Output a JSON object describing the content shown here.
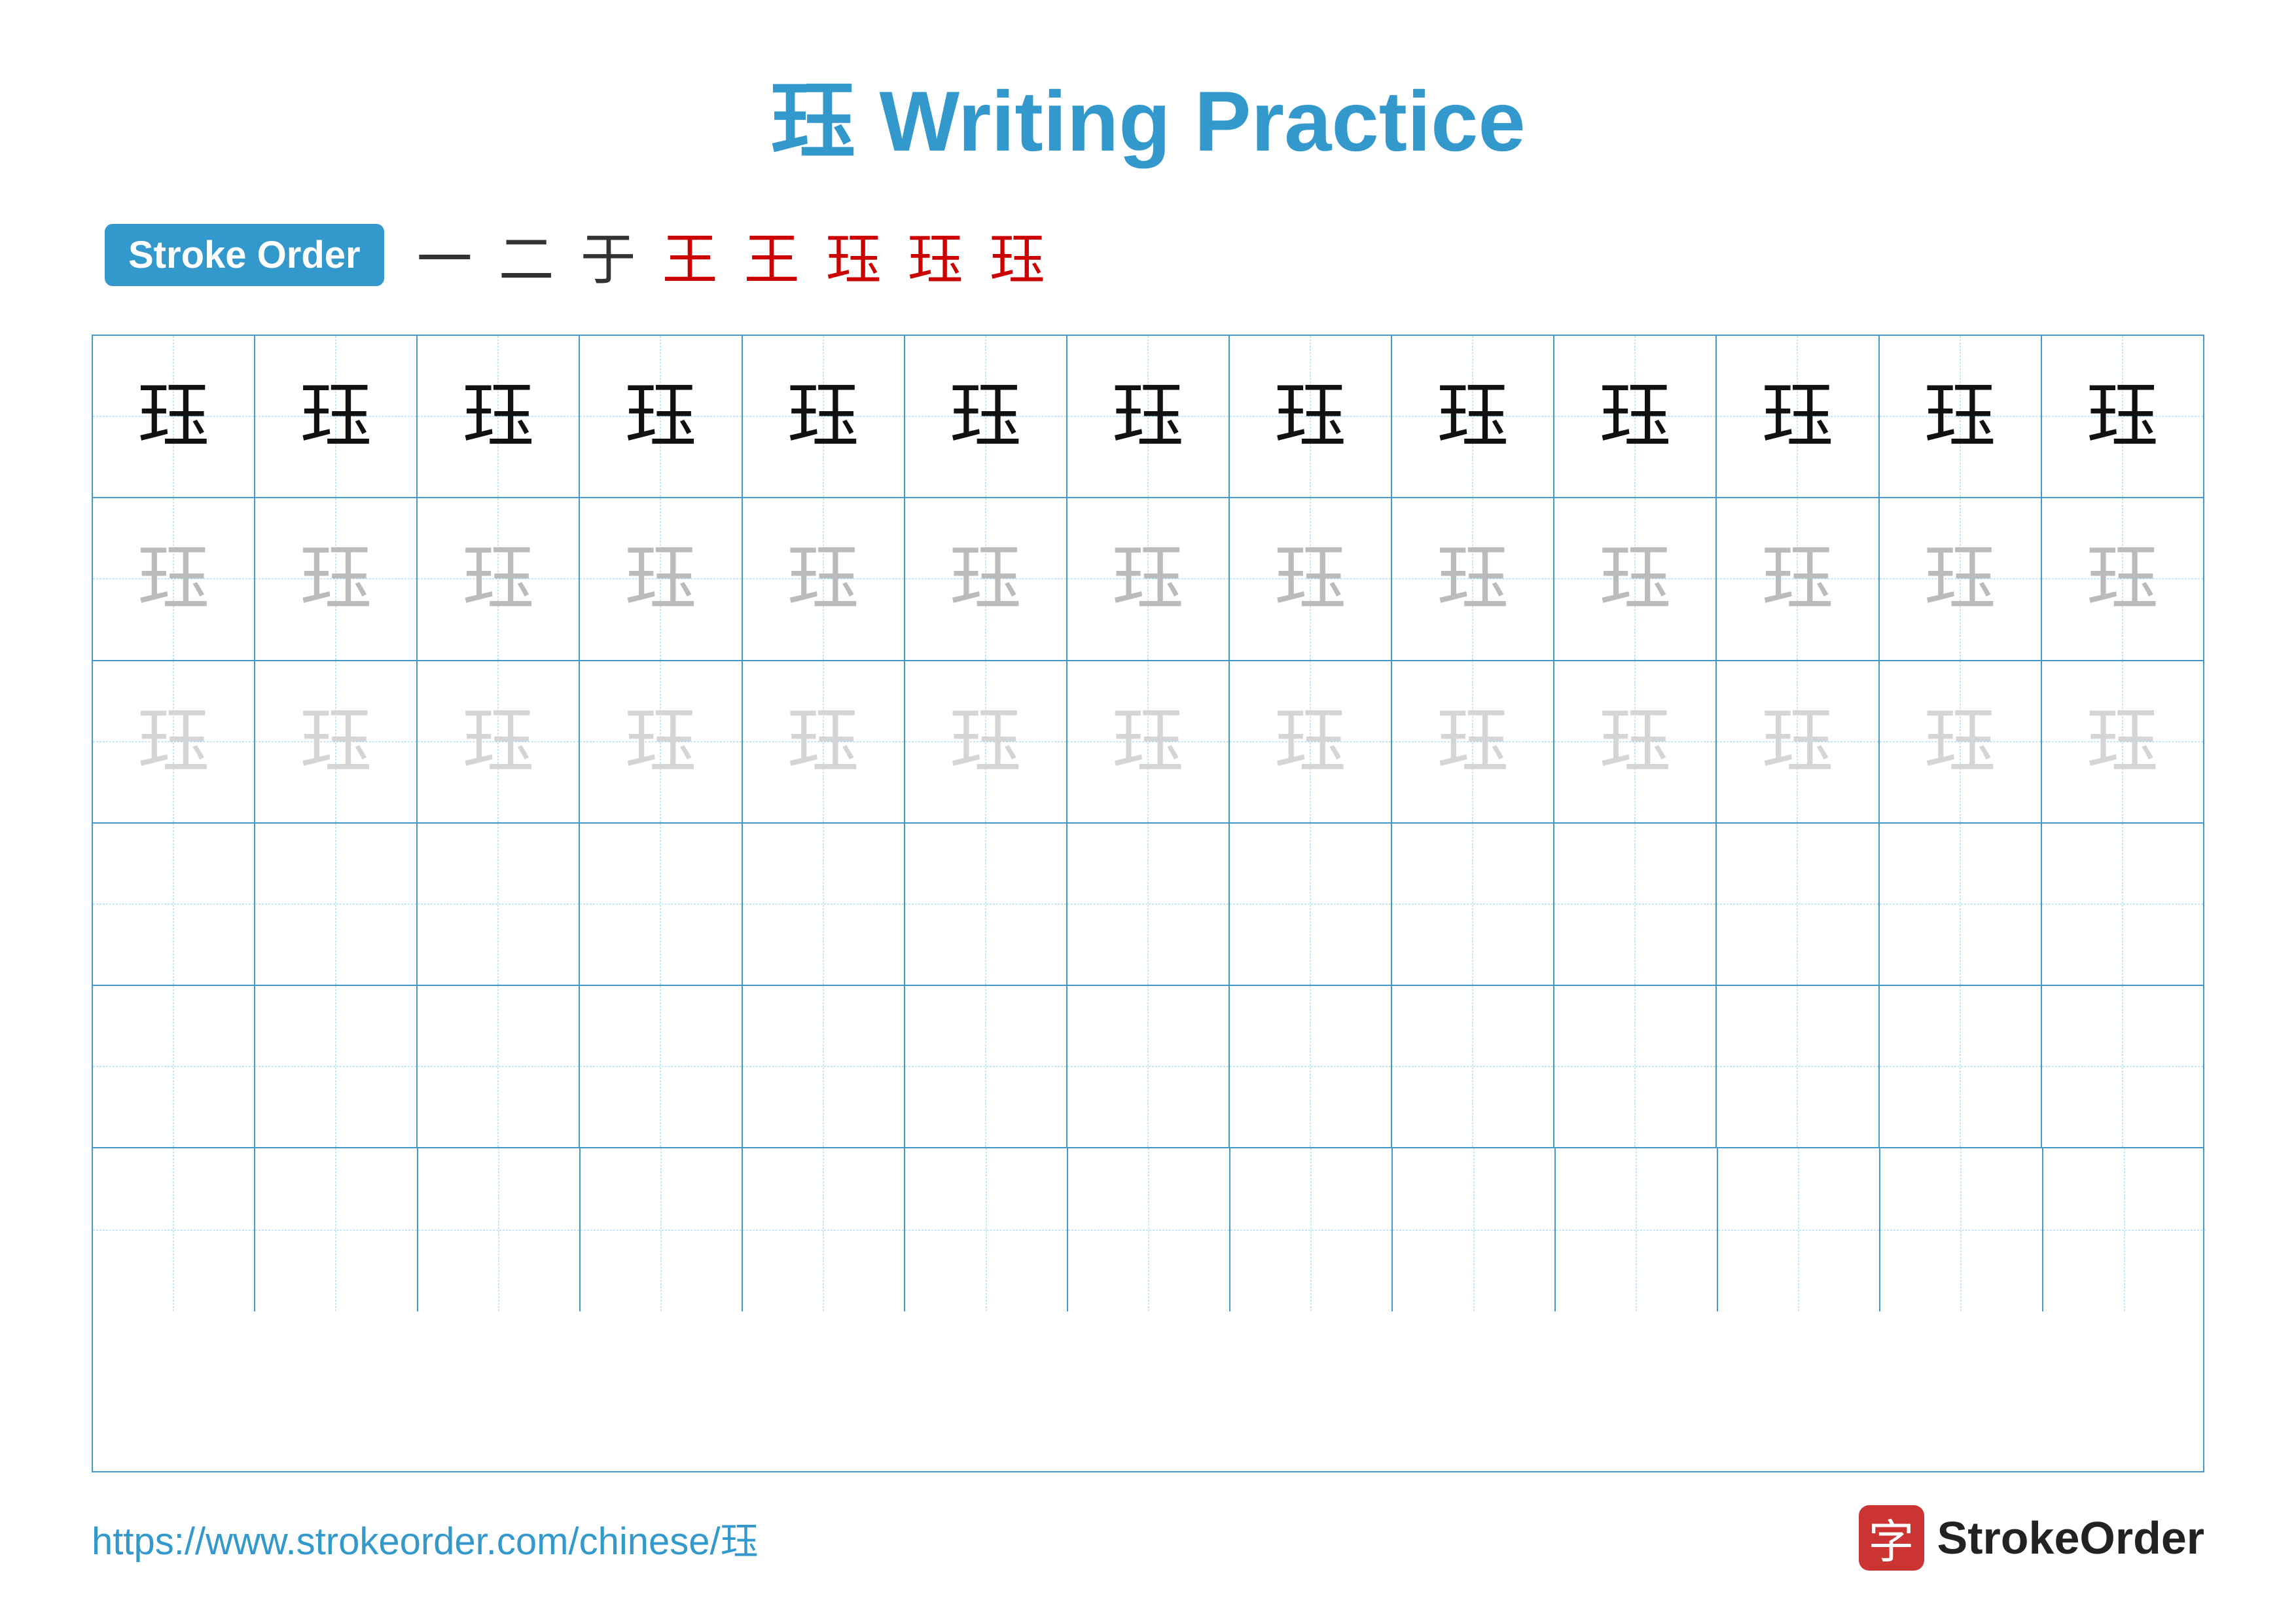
{
  "title": {
    "chinese": "珏",
    "english": "Writing Practice",
    "full": "珏 Writing Practice"
  },
  "stroke_order": {
    "badge_label": "Stroke Order",
    "strokes": [
      "一",
      "二",
      "于",
      "王",
      "王̄",
      "珏̲",
      "珏̳",
      "珏"
    ]
  },
  "grid": {
    "rows": 6,
    "cols": 13,
    "character": "珏",
    "row_types": [
      "dark",
      "medium",
      "light",
      "empty",
      "empty",
      "empty"
    ]
  },
  "footer": {
    "url": "https://www.strokeorder.com/chinese/珏",
    "brand_char": "字",
    "brand_name": "StrokeOrder"
  }
}
